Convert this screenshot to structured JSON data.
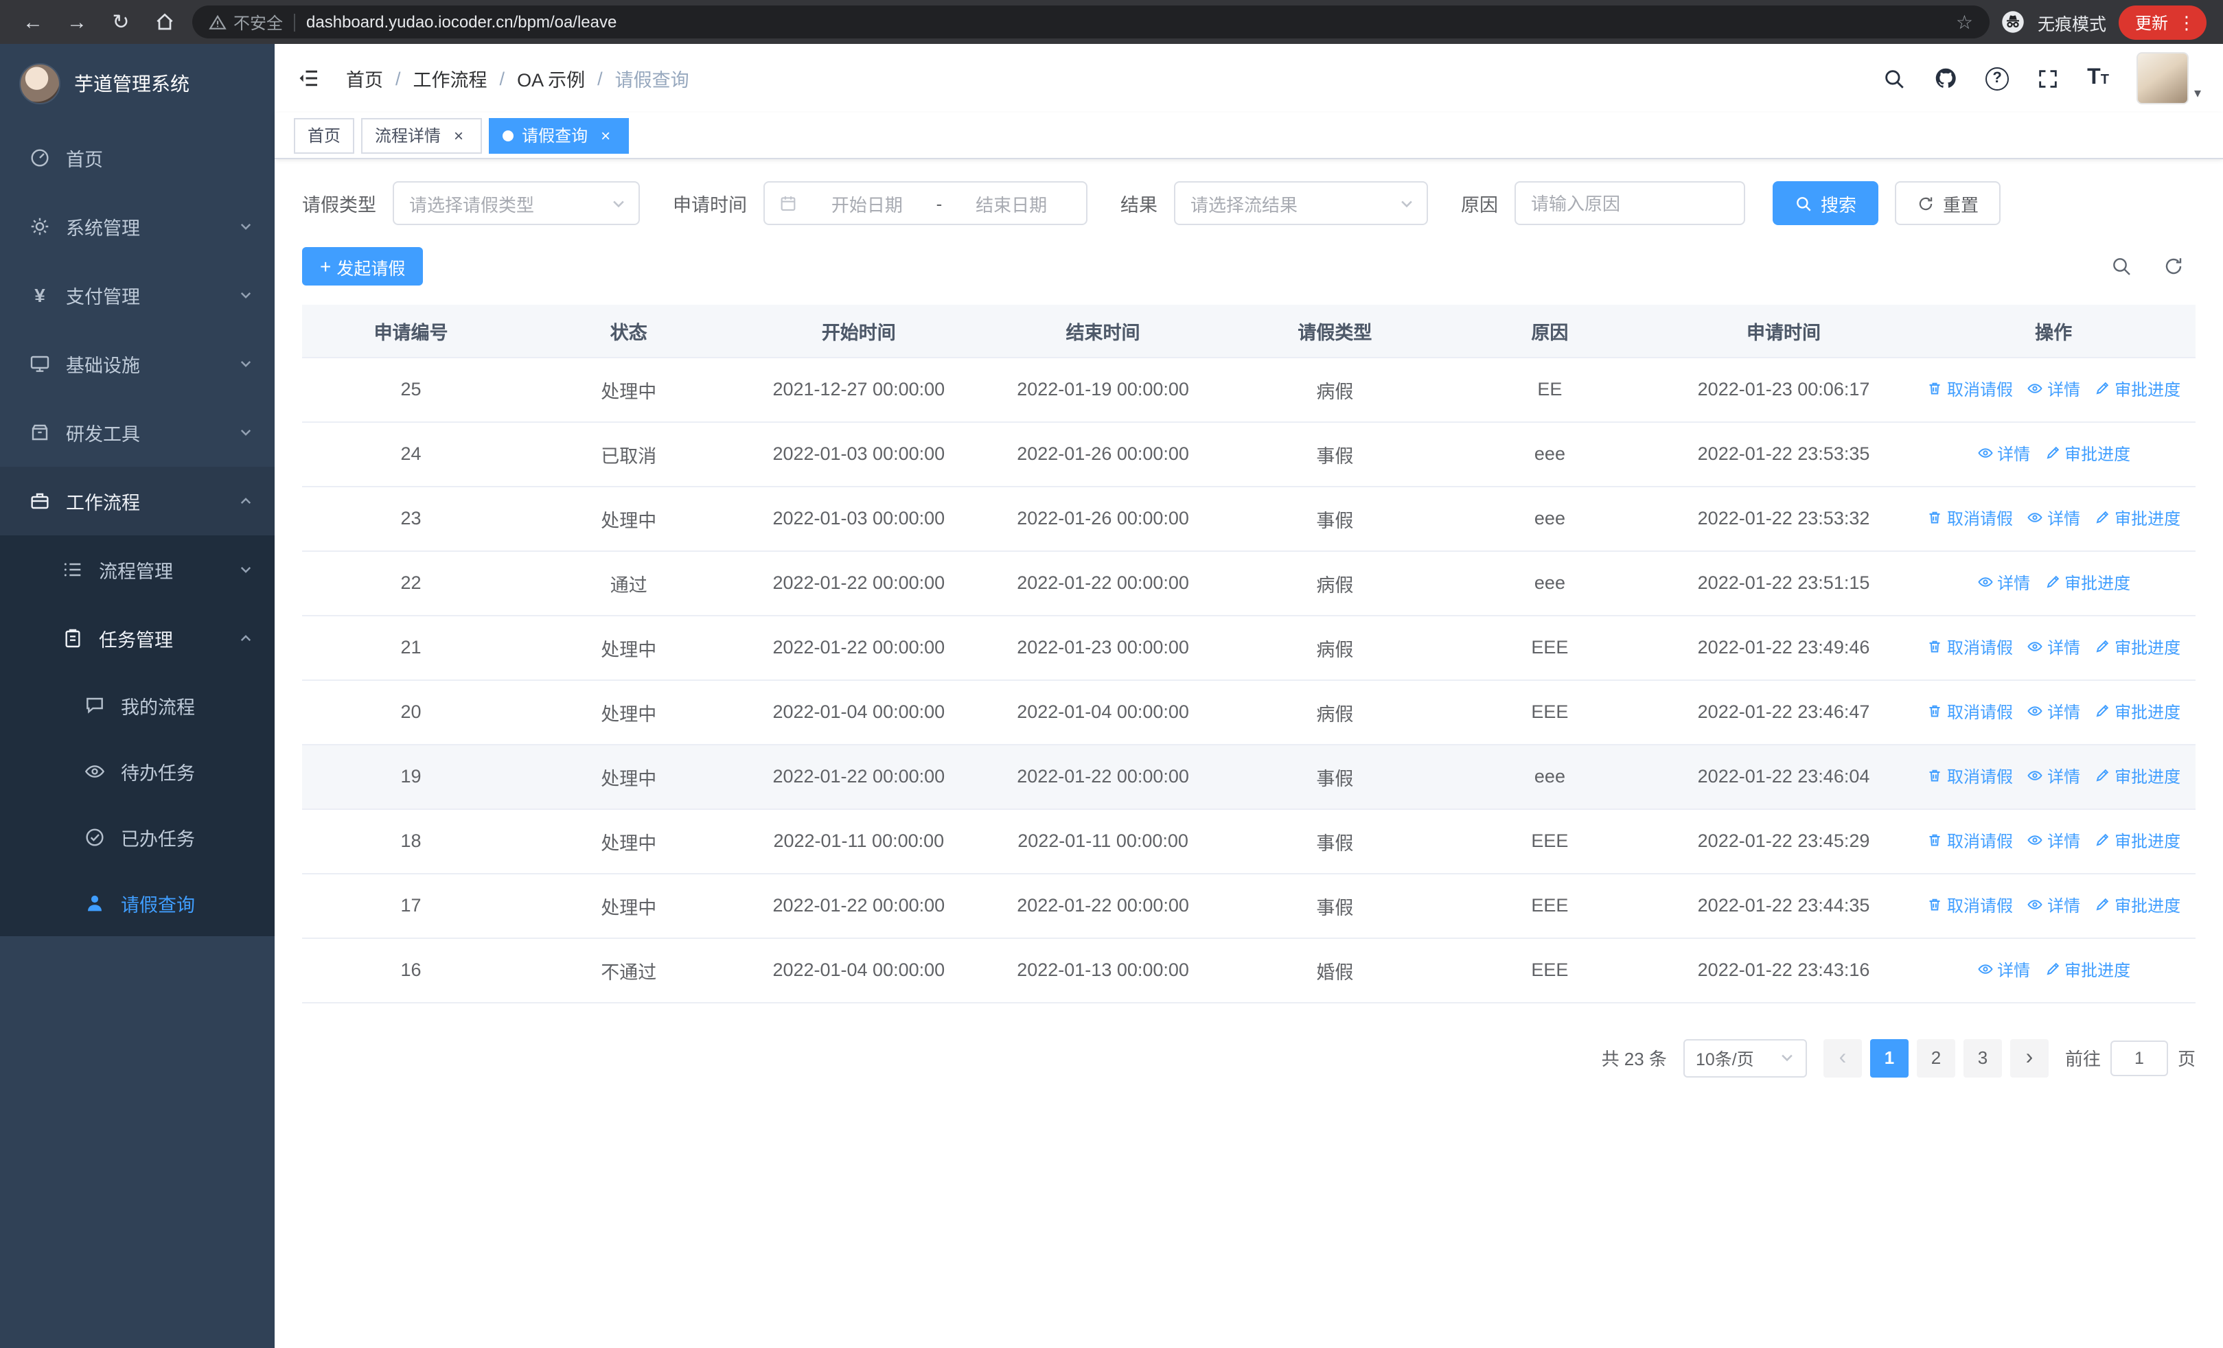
{
  "colors": {
    "primary": "#409eff",
    "sidebar": "#304156",
    "submenu": "#1f2d3d"
  },
  "browser": {
    "security_label": "不安全",
    "url": "dashboard.yudao.iocoder.cn/bpm/oa/leave",
    "incognito_label": "无痕模式",
    "update_label": "更新"
  },
  "sidebar": {
    "app_title": "芋道管理系统",
    "items": [
      {
        "label": "首页"
      },
      {
        "label": "系统管理"
      },
      {
        "label": "支付管理"
      },
      {
        "label": "基础设施"
      },
      {
        "label": "研发工具"
      },
      {
        "label": "工作流程"
      },
      {
        "label": "流程管理"
      },
      {
        "label": "任务管理"
      },
      {
        "label": "我的流程"
      },
      {
        "label": "待办任务"
      },
      {
        "label": "已办任务"
      },
      {
        "label": "请假查询"
      }
    ]
  },
  "header": {
    "breadcrumb": [
      "首页",
      "工作流程",
      "OA 示例",
      "请假查询"
    ]
  },
  "tabs": [
    {
      "label": "首页",
      "closable": false,
      "active": false
    },
    {
      "label": "流程详情",
      "closable": true,
      "active": false
    },
    {
      "label": "请假查询",
      "closable": true,
      "active": true
    }
  ],
  "filters": {
    "type_label": "请假类型",
    "type_placeholder": "请选择请假类型",
    "time_label": "申请时间",
    "start_placeholder": "开始日期",
    "range_separator": "-",
    "end_placeholder": "结束日期",
    "result_label": "结果",
    "result_placeholder": "请选择流结果",
    "reason_label": "原因",
    "reason_placeholder": "请输入原因",
    "search_label": "搜索",
    "reset_label": "重置"
  },
  "toolbar": {
    "create_label": "发起请假"
  },
  "table": {
    "columns": [
      "申请编号",
      "状态",
      "开始时间",
      "结束时间",
      "请假类型",
      "原因",
      "申请时间",
      "操作"
    ],
    "action_defs": {
      "cancel": {
        "label": "取消请假",
        "icon": "delete-icon"
      },
      "detail": {
        "label": "详情",
        "icon": "eye-icon"
      },
      "progress": {
        "label": "审批进度",
        "icon": "edit-icon"
      }
    },
    "rows": [
      {
        "id": "25",
        "status": "处理中",
        "start": "2021-12-27 00:00:00",
        "end": "2022-01-19 00:00:00",
        "type": "病假",
        "reason": "EE",
        "apply": "2022-01-23 00:06:17",
        "actions": [
          "cancel",
          "detail",
          "progress"
        ],
        "highlight": false
      },
      {
        "id": "24",
        "status": "已取消",
        "start": "2022-01-03 00:00:00",
        "end": "2022-01-26 00:00:00",
        "type": "事假",
        "reason": "eee",
        "apply": "2022-01-22 23:53:35",
        "actions": [
          "detail",
          "progress"
        ],
        "highlight": false
      },
      {
        "id": "23",
        "status": "处理中",
        "start": "2022-01-03 00:00:00",
        "end": "2022-01-26 00:00:00",
        "type": "事假",
        "reason": "eee",
        "apply": "2022-01-22 23:53:32",
        "actions": [
          "cancel",
          "detail",
          "progress"
        ],
        "highlight": false
      },
      {
        "id": "22",
        "status": "通过",
        "start": "2022-01-22 00:00:00",
        "end": "2022-01-22 00:00:00",
        "type": "病假",
        "reason": "eee",
        "apply": "2022-01-22 23:51:15",
        "actions": [
          "detail",
          "progress"
        ],
        "highlight": false
      },
      {
        "id": "21",
        "status": "处理中",
        "start": "2022-01-22 00:00:00",
        "end": "2022-01-23 00:00:00",
        "type": "病假",
        "reason": "EEE",
        "apply": "2022-01-22 23:49:46",
        "actions": [
          "cancel",
          "detail",
          "progress"
        ],
        "highlight": false
      },
      {
        "id": "20",
        "status": "处理中",
        "start": "2022-01-04 00:00:00",
        "end": "2022-01-04 00:00:00",
        "type": "病假",
        "reason": "EEE",
        "apply": "2022-01-22 23:46:47",
        "actions": [
          "cancel",
          "detail",
          "progress"
        ],
        "highlight": false
      },
      {
        "id": "19",
        "status": "处理中",
        "start": "2022-01-22 00:00:00",
        "end": "2022-01-22 00:00:00",
        "type": "事假",
        "reason": "eee",
        "apply": "2022-01-22 23:46:04",
        "actions": [
          "cancel",
          "detail",
          "progress"
        ],
        "highlight": true
      },
      {
        "id": "18",
        "status": "处理中",
        "start": "2022-01-11 00:00:00",
        "end": "2022-01-11 00:00:00",
        "type": "事假",
        "reason": "EEE",
        "apply": "2022-01-22 23:45:29",
        "actions": [
          "cancel",
          "detail",
          "progress"
        ],
        "highlight": false
      },
      {
        "id": "17",
        "status": "处理中",
        "start": "2022-01-22 00:00:00",
        "end": "2022-01-22 00:00:00",
        "type": "事假",
        "reason": "EEE",
        "apply": "2022-01-22 23:44:35",
        "actions": [
          "cancel",
          "detail",
          "progress"
        ],
        "highlight": false
      },
      {
        "id": "16",
        "status": "不通过",
        "start": "2022-01-04 00:00:00",
        "end": "2022-01-13 00:00:00",
        "type": "婚假",
        "reason": "EEE",
        "apply": "2022-01-22 23:43:16",
        "actions": [
          "detail",
          "progress"
        ],
        "highlight": false
      }
    ]
  },
  "pagination": {
    "total_label": "共 23 条",
    "page_size": "10条/页",
    "pages": [
      "1",
      "2",
      "3"
    ],
    "active_page": "1",
    "goto_label": "前往",
    "goto_value": "1",
    "page_suffix": "页"
  }
}
